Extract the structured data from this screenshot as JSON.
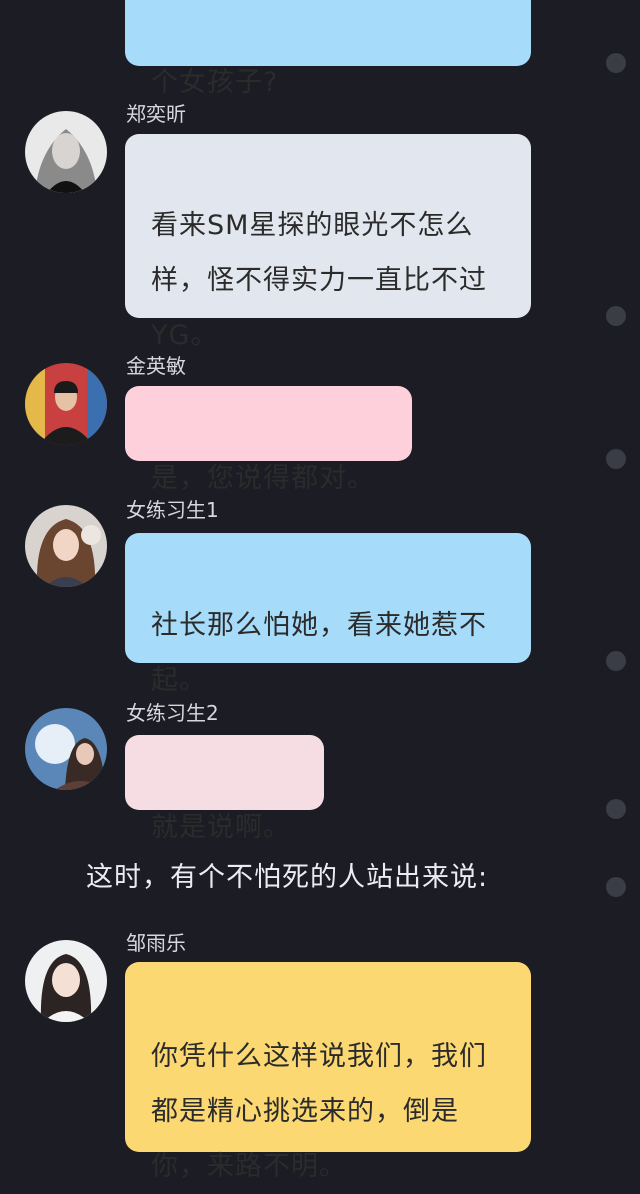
{
  "messages": [
    {
      "id": "m0",
      "name": "",
      "text": "个女孩子?",
      "color": "blue"
    },
    {
      "id": "m1",
      "name": "郑奕昕",
      "text": "看来SM星探的眼光不怎么\n样，怪不得实力一直比不过\nYG。",
      "color": "gray",
      "avatar_icon": "woman-avatar-icon"
    },
    {
      "id": "m2",
      "name": "金英敏",
      "text": "是，您说得都对。",
      "color": "pink",
      "avatar_icon": "man-avatar-icon"
    },
    {
      "id": "m3",
      "name": "女练习生1",
      "text": "社长那么怕她，看来她惹不\n起。",
      "color": "blue",
      "avatar_icon": "girl-avatar-icon"
    },
    {
      "id": "m4",
      "name": "女练习生2",
      "text": "就是说啊。",
      "color": "lightpink",
      "avatar_icon": "girl-avatar-icon"
    },
    {
      "id": "m5",
      "name": "邹雨乐",
      "text": "你凭什么这样说我们，我们\n都是精心挑选来的，倒是\n你，来路不明。",
      "color": "yellow",
      "avatar_icon": "girl-avatar-icon"
    }
  ],
  "narration": "这时，有个不怕死的人站出来说:",
  "colors": {
    "background": "#1b1c24",
    "blue": "#a6dcfa",
    "gray": "#e2e6ee",
    "pink": "#fdd0dc",
    "lightpink": "#f6dde4",
    "yellow": "#fcd872"
  }
}
